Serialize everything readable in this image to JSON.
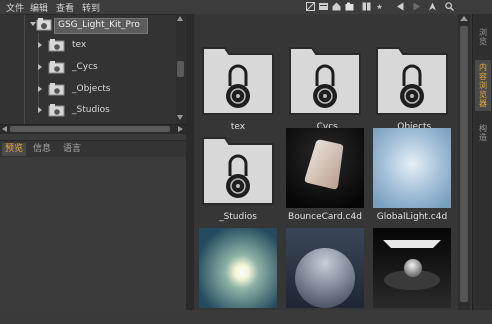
{
  "menubar": {
    "items": [
      "文件",
      "编辑",
      "查看",
      "转到"
    ],
    "icons": [
      "view-mode-icon",
      "list-icon",
      "home-icon",
      "folder-up-icon",
      "bookmark-icon",
      "star-icon",
      "back-icon",
      "forward-icon",
      "navigate-icon",
      "search-icon"
    ]
  },
  "tree": {
    "root": "GSG_Light_Kit_Pro",
    "items": [
      "tex",
      "_Cycs",
      "_Objects",
      "_Studios"
    ]
  },
  "left_tabs": [
    "预览",
    "信息",
    "语言"
  ],
  "side_tabs": [
    "浏览",
    "内容浏览器",
    "构造"
  ],
  "grid": {
    "items": [
      {
        "label": "tex",
        "type": "locked-folder"
      },
      {
        "label": "_Cycs",
        "type": "locked-folder"
      },
      {
        "label": "_Objects",
        "type": "locked-folder"
      },
      {
        "label": "_Studios",
        "type": "locked-folder"
      },
      {
        "label": "BounceCard.c4d",
        "type": "bounce-card"
      },
      {
        "label": "GlobalLight.c4d",
        "type": "global-light"
      },
      {
        "label": "",
        "type": "sun-sky"
      },
      {
        "label": "",
        "type": "sphere"
      },
      {
        "label": "",
        "type": "studio"
      }
    ]
  },
  "colors": {
    "accent": "#e9a83b",
    "panel": "#363636",
    "selection": "#5a5a5a"
  }
}
